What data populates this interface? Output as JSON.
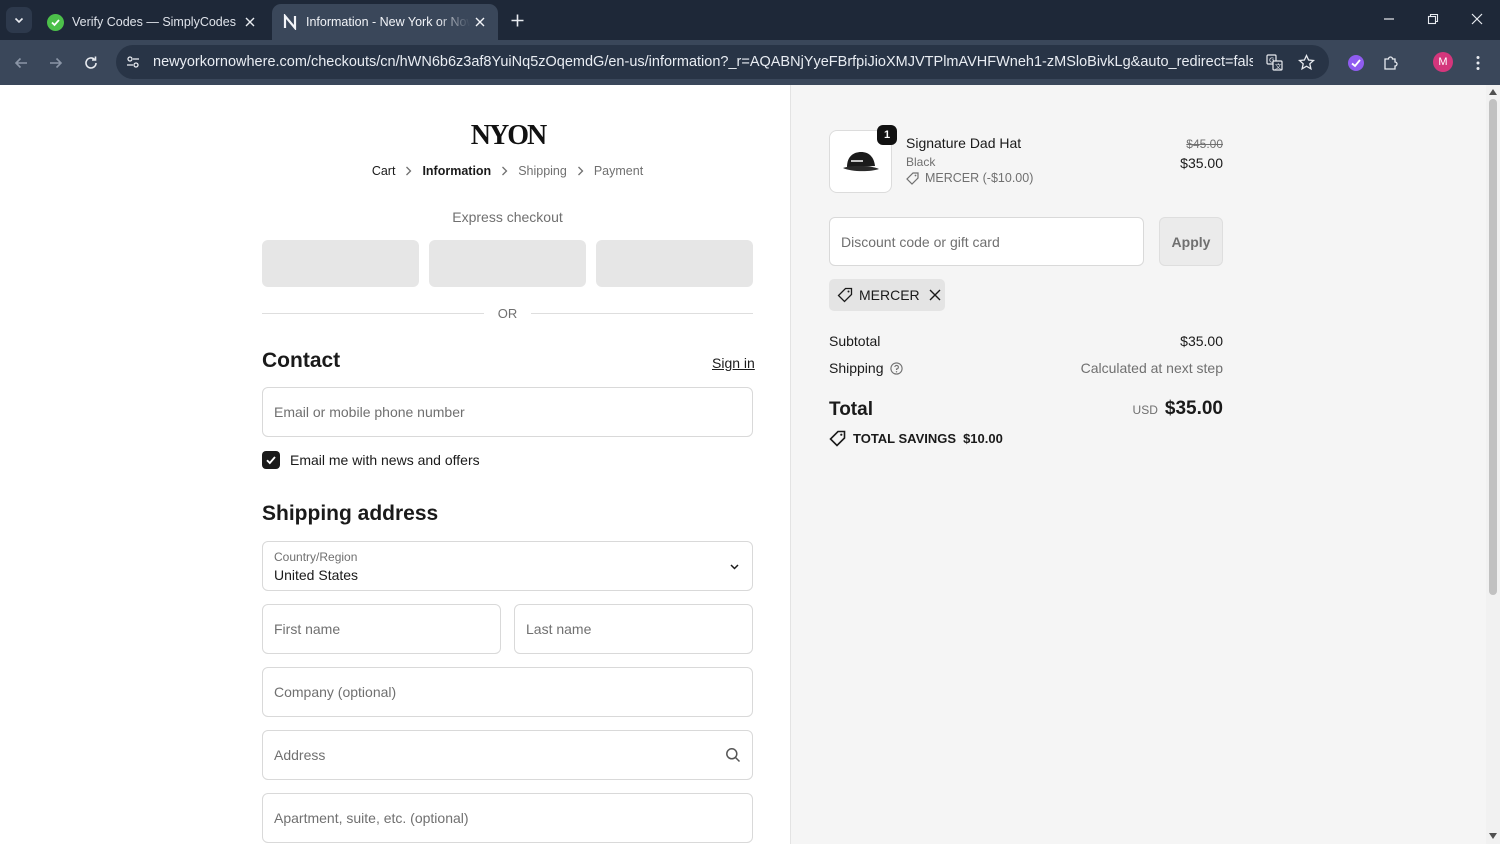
{
  "browser": {
    "tabs": [
      {
        "title": "Verify Codes — SimplyCodes",
        "favicon": "simplycodes-icon",
        "active": false
      },
      {
        "title": "Information - New York or Nowhere",
        "favicon": "nyon-icon",
        "active": true
      }
    ],
    "url": "newyorkornowhere.com/checkouts/cn/hWN6b6z3af8YuiNq5zOqemdG/en-us/information?_r=AQABNjYyeFBrfpiJioXMJVTPlmAVHFWneh1-zMSloBivkLg&auto_redirect=false&edge_r...",
    "profile_initial": "M",
    "colors": {
      "tabbar": "#1e2838",
      "toolbar": "#3a475a",
      "omnibox": "#283446",
      "profile": "#d4367c"
    }
  },
  "checkout": {
    "logo": "NYON",
    "breadcrumb": [
      "Cart",
      "Information",
      "Shipping",
      "Payment"
    ],
    "express_checkout_label": "Express checkout",
    "or_label": "OR",
    "contact": {
      "title": "Contact",
      "sign_in": "Sign in",
      "email_placeholder": "Email or mobile phone number",
      "newsletter_label": "Email me with news and offers",
      "newsletter_checked": true
    },
    "shipping": {
      "title": "Shipping address",
      "country_label": "Country/Region",
      "country_value": "United States",
      "first_name_placeholder": "First name",
      "last_name_placeholder": "Last name",
      "company_placeholder": "Company (optional)",
      "address_placeholder": "Address",
      "apartment_placeholder": "Apartment, suite, etc. (optional)"
    }
  },
  "summary": {
    "product": {
      "quantity": "1",
      "name": "Signature Dad Hat",
      "variant": "Black",
      "discount_line": "MERCER (-$10.00)",
      "original_price": "$45.00",
      "price": "$35.00"
    },
    "discount_placeholder": "Discount code or gift card",
    "apply_label": "Apply",
    "applied_code": "MERCER",
    "subtotal_label": "Subtotal",
    "subtotal_value": "$35.00",
    "shipping_label": "Shipping",
    "shipping_value": "Calculated at next step",
    "total_label": "Total",
    "total_currency": "USD",
    "total_value": "$35.00",
    "savings_label": "TOTAL SAVINGS",
    "savings_value": "$10.00"
  }
}
